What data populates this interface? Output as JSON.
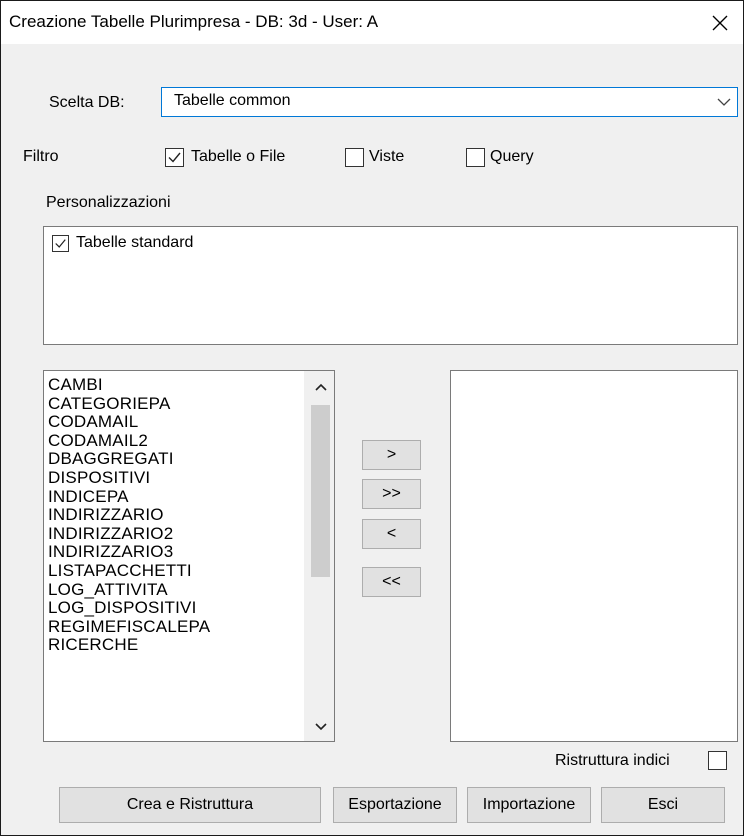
{
  "window": {
    "title": "Creazione Tabelle Plurimpresa - DB: 3d - User: A"
  },
  "db": {
    "label": "Scelta DB:",
    "selected": "Tabelle common"
  },
  "filter": {
    "label": "Filtro",
    "options": [
      {
        "label": "Tabelle o File",
        "checked": true
      },
      {
        "label": "Viste",
        "checked": false
      },
      {
        "label": "Query",
        "checked": false
      }
    ]
  },
  "personalizations": {
    "label": "Personalizzazioni",
    "items": [
      {
        "label": "Tabelle standard",
        "checked": true
      }
    ]
  },
  "source_list": {
    "items": [
      "CAMBI",
      "CATEGORIEPA",
      "CODAMAIL",
      "CODAMAIL2",
      "DBAGGREGATI",
      "DISPOSITIVI",
      "INDICEPA",
      "INDIRIZZARIO",
      "INDIRIZZARIO2",
      "INDIRIZZARIO3",
      "LISTAPACCHETTI",
      "LOG_ATTIVITA",
      "LOG_DISPOSITIVI",
      "REGIMEFISCALEPA",
      "RICERCHE"
    ]
  },
  "transfer": {
    "add": ">",
    "add_all": ">>",
    "remove": "<",
    "remove_all": "<<"
  },
  "rebuild_indexes": {
    "label": "Ristruttura indici",
    "checked": false
  },
  "actions": {
    "create": "Crea e Ristruttura",
    "export": "Esportazione",
    "import": "Importazione",
    "exit": "Esci"
  }
}
